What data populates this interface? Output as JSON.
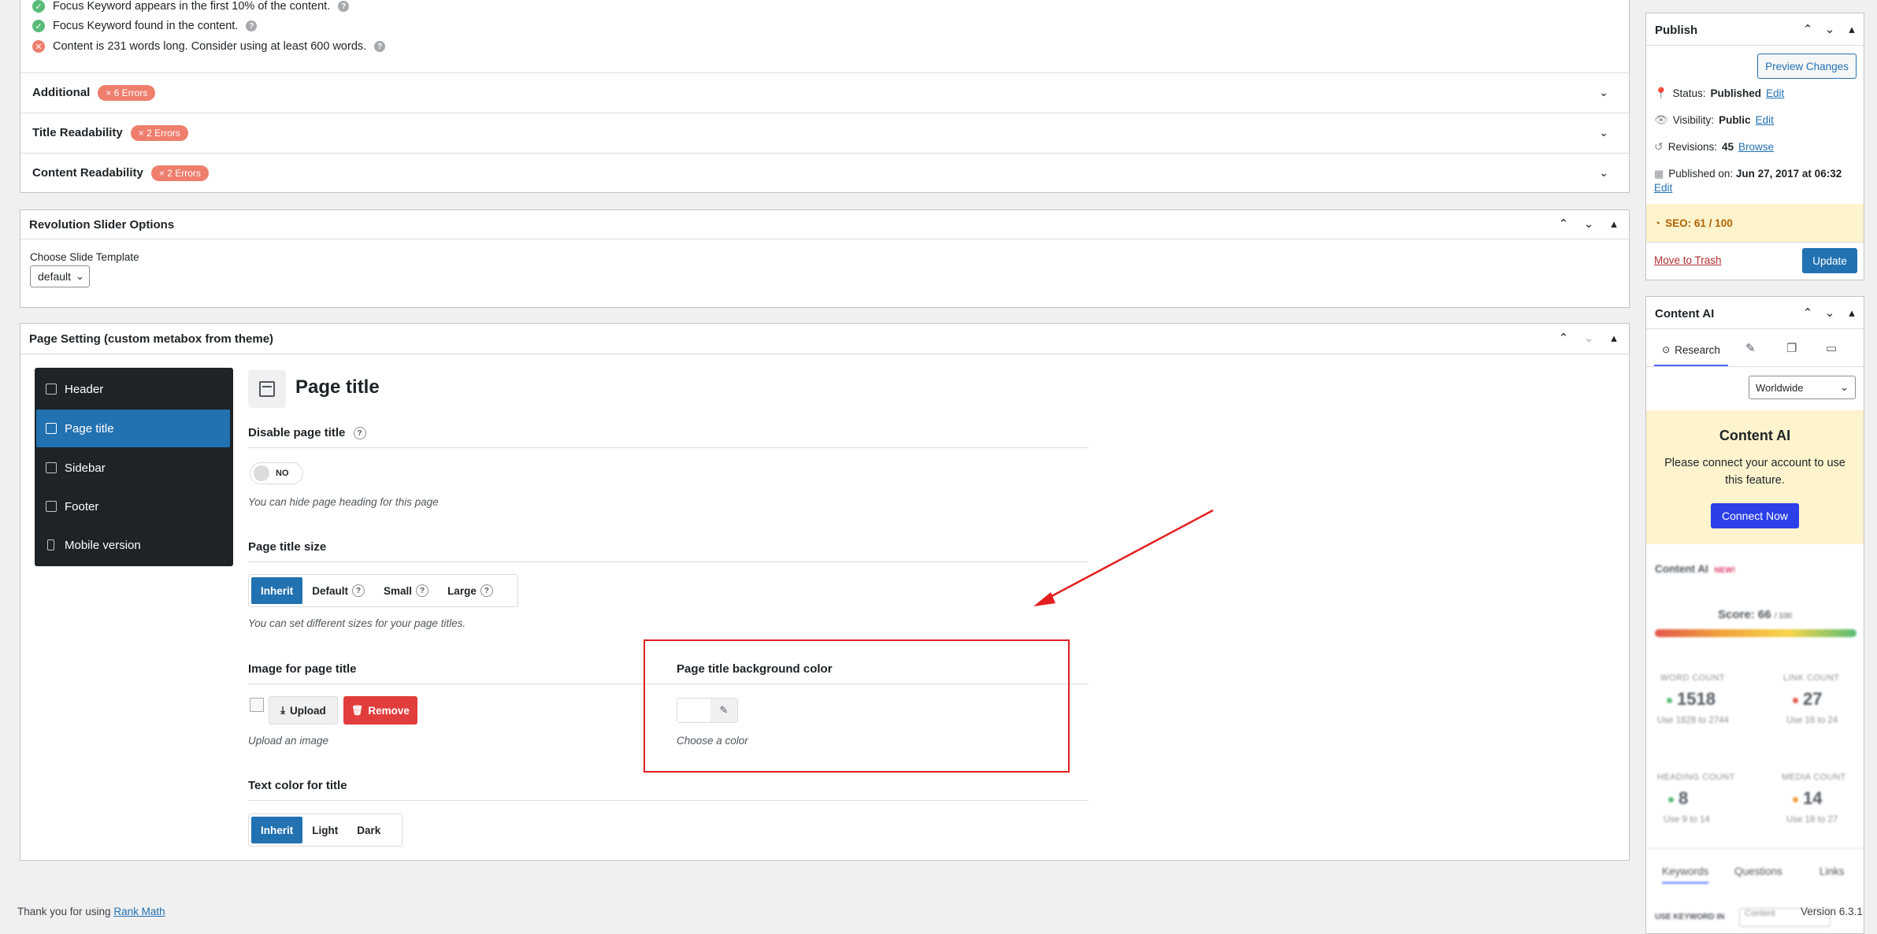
{
  "seo_checks": [
    {
      "status": "ok",
      "text": "Focus Keyword appears in the first 10% of the content."
    },
    {
      "status": "ok",
      "text": "Focus Keyword found in the content."
    },
    {
      "status": "bad",
      "text": "Content is 231 words long. Consider using at least 600 words."
    }
  ],
  "seo_sections": [
    {
      "label": "Additional",
      "badge": "× 6 Errors"
    },
    {
      "label": "Title Readability",
      "badge": "× 2 Errors"
    },
    {
      "label": "Content Readability",
      "badge": "× 2 Errors"
    }
  ],
  "revolution": {
    "title": "Revolution Slider Options",
    "template_label": "Choose Slide Template",
    "template_value": "default"
  },
  "page_setting": {
    "title": "Page Setting (custom metabox from theme)",
    "nav": [
      {
        "label": "Header"
      },
      {
        "label": "Page title"
      },
      {
        "label": "Sidebar"
      },
      {
        "label": "Footer"
      },
      {
        "label": "Mobile version"
      }
    ],
    "heading": "Page title",
    "disable_label": "Disable page title",
    "toggle_value": "NO",
    "disable_help": "You can hide page heading for this page",
    "size_label": "Page title size",
    "size_options": [
      "Inherit",
      "Default",
      "Small",
      "Large"
    ],
    "size_help": "You can set different sizes for your page titles.",
    "image_label": "Image for page title",
    "upload_label": "Upload",
    "remove_label": "Remove",
    "image_help": "Upload an image",
    "bg_color_label": "Page title background color",
    "bg_color_help": "Choose a color",
    "text_color_label": "Text color for title",
    "text_color_options": [
      "Inherit",
      "Light",
      "Dark"
    ]
  },
  "publish": {
    "title": "Publish",
    "preview_label": "Preview Changes",
    "status_label": "Status:",
    "status_value": "Published",
    "visibility_label": "Visibility:",
    "visibility_value": "Public",
    "revisions_label": "Revisions:",
    "revisions_value": "45",
    "browse_label": "Browse",
    "published_label": "Published on:",
    "published_value": "Jun 27, 2017 at 06:32",
    "edit_label": "Edit",
    "seo_score": "SEO: 61 / 100",
    "trash_label": "Move to Trash",
    "update_label": "Update"
  },
  "content_ai": {
    "title": "Content AI",
    "tab_research": "Research",
    "region": "Worldwide",
    "heading": "Content AI",
    "message": "Please connect your account to use this feature.",
    "connect_label": "Connect Now",
    "brand": "Content AI",
    "new_badge": "NEW!",
    "score_label": "Score: 66",
    "score_total": "/ 100",
    "metrics": [
      {
        "label": "WORD COUNT",
        "value": "1518",
        "hint": "Use 1828 to 2744",
        "color": "#58bb77"
      },
      {
        "label": "LINK COUNT",
        "value": "27",
        "hint": "Use 16 to 24",
        "color": "#e2574c"
      },
      {
        "label": "HEADING COUNT",
        "value": "8",
        "hint": "Use 9 to 14",
        "color": "#58bb77"
      },
      {
        "label": "MEDIA COUNT",
        "value": "14",
        "hint": "Use 18 to 27",
        "color": "#f0a23a"
      }
    ],
    "bottom_tabs": [
      "Keywords",
      "Questions",
      "Links"
    ],
    "use_keyword": "USE KEYWORD IN",
    "use_keyword_value": "Content"
  },
  "footer": {
    "thanks": "Thank you for using",
    "link": "Rank Math",
    "version": "Version 6.3.1"
  },
  "colors": {
    "accent": "#2271b1",
    "error": "#ef7e6d",
    "remove": "#e23d3d",
    "highlight": "#e31e1e",
    "sidebar_bg": "#1d2327"
  }
}
